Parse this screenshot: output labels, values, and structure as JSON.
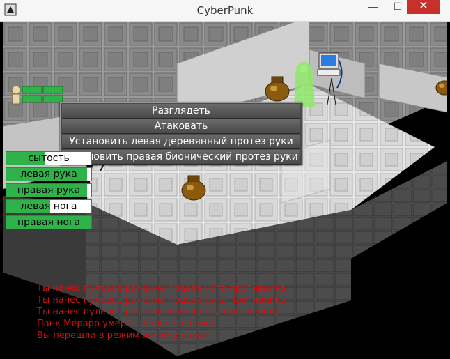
{
  "window": {
    "title": "CyberPunk",
    "minimize_label": "—",
    "maximize_label": "☐",
    "close_label": "✕"
  },
  "context_menu": {
    "items": [
      "Разглядеть",
      "Атаковать",
      "Установить левая деревянный протез руки",
      "Установить правая бионический протез руки"
    ]
  },
  "body_status": {
    "items": [
      {
        "label": "сытость",
        "fill": 0.45
      },
      {
        "label": "левая рука",
        "fill": 0.95
      },
      {
        "label": "правая рука",
        "fill": 0.95
      },
      {
        "label": "левая нога",
        "fill": 0.52
      },
      {
        "label": "правая нога",
        "fill": 1.0
      }
    ]
  },
  "player_health": {
    "segments": 4
  },
  "log": {
    "lines": [
      "Ты нанес пулевое ранение правая нога противника",
      "Ты нанес пулевое ранение правая рука противника",
      "Ты нанес пулевое ранение левая нога противника",
      "Панк Мерарр умер от болевого шока",
      "Вы перешли в режим исследования"
    ]
  },
  "colors": {
    "menu_bg": "#4a4a4a",
    "bar_fill": "#2fb24a",
    "log_text": "#cc1111",
    "close_button": "#c7302b"
  }
}
